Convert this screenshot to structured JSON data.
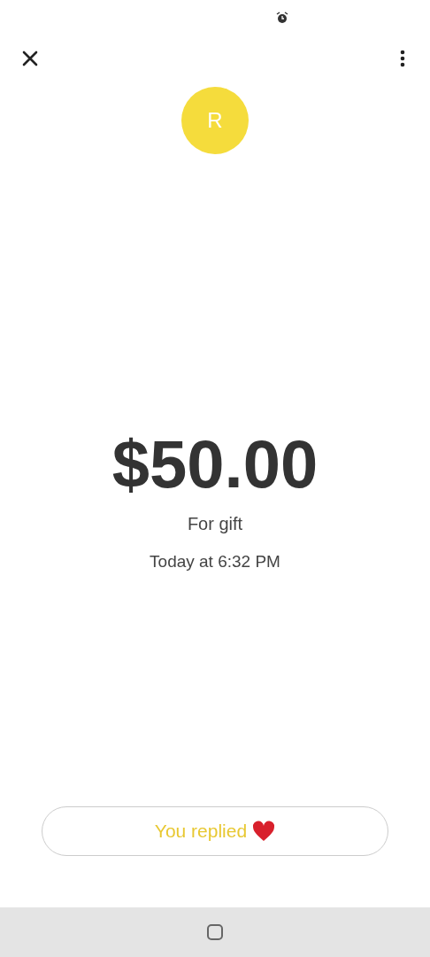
{
  "header": {
    "avatar_initial": "R"
  },
  "payment": {
    "amount": "$50.00",
    "note": "For gift",
    "time": "Today at 6:32 PM"
  },
  "reply": {
    "label": "You replied"
  }
}
